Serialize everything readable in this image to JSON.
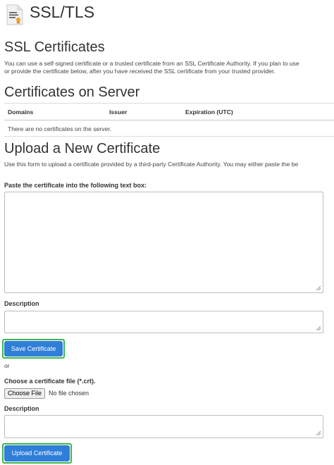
{
  "header": {
    "title": "SSL/TLS",
    "icon": "certificate-document-icon"
  },
  "ssl_certificates": {
    "heading": "SSL Certificates",
    "description_line1": "You can use a self-signed certificate or a trusted certificate from an SSL Certificate Authority. If you plan to use",
    "description_line2": "or provide the certificate below, after you have received the SSL certificate from your trusted provider."
  },
  "certificates_on_server": {
    "heading": "Certificates on Server",
    "columns": [
      "Domains",
      "Issuer",
      "Expiration (UTC)"
    ],
    "empty_message": "There are no certificates on the server."
  },
  "upload": {
    "heading": "Upload a New Certificate",
    "description": "Use this form to upload a certificate provided by a third-party Certificate Authority. You may either paste the be",
    "paste_label": "Paste the certificate into the following text box:",
    "paste_value": "",
    "description_label": "Description",
    "description_value": "",
    "save_button": "Save Certificate",
    "or_text": "or",
    "file_label": "Choose a certificate file (*.crt).",
    "choose_file_button": "Choose File",
    "no_file_text": "No file chosen",
    "description_label_2": "Description",
    "description_value_2": "",
    "upload_button": "Upload Certificate"
  },
  "colors": {
    "button": "#2f7ed8",
    "highlight": "#3db54a"
  }
}
